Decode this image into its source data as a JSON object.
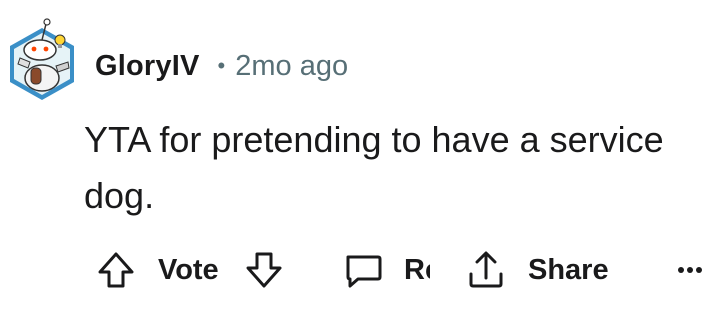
{
  "comment": {
    "username": "GloryIV",
    "separator": "•",
    "timestamp": "2mo ago",
    "body": "YTA for pretending to have a service dog."
  },
  "actions": {
    "vote_label": "Vote",
    "reply_label": "Reply",
    "share_label": "Share",
    "more_label": "•••"
  },
  "icons": {
    "avatar": "snoo-avatar-icon",
    "upvote": "arrow-up-icon",
    "downvote": "arrow-down-icon",
    "reply": "speech-bubble-icon",
    "share": "share-icon",
    "more": "more-dots-icon"
  },
  "colors": {
    "text": "#1a1a1b",
    "meta": "#576f76",
    "avatar_ring": "#3a8fc7",
    "avatar_bg": "#e6f3f7"
  }
}
